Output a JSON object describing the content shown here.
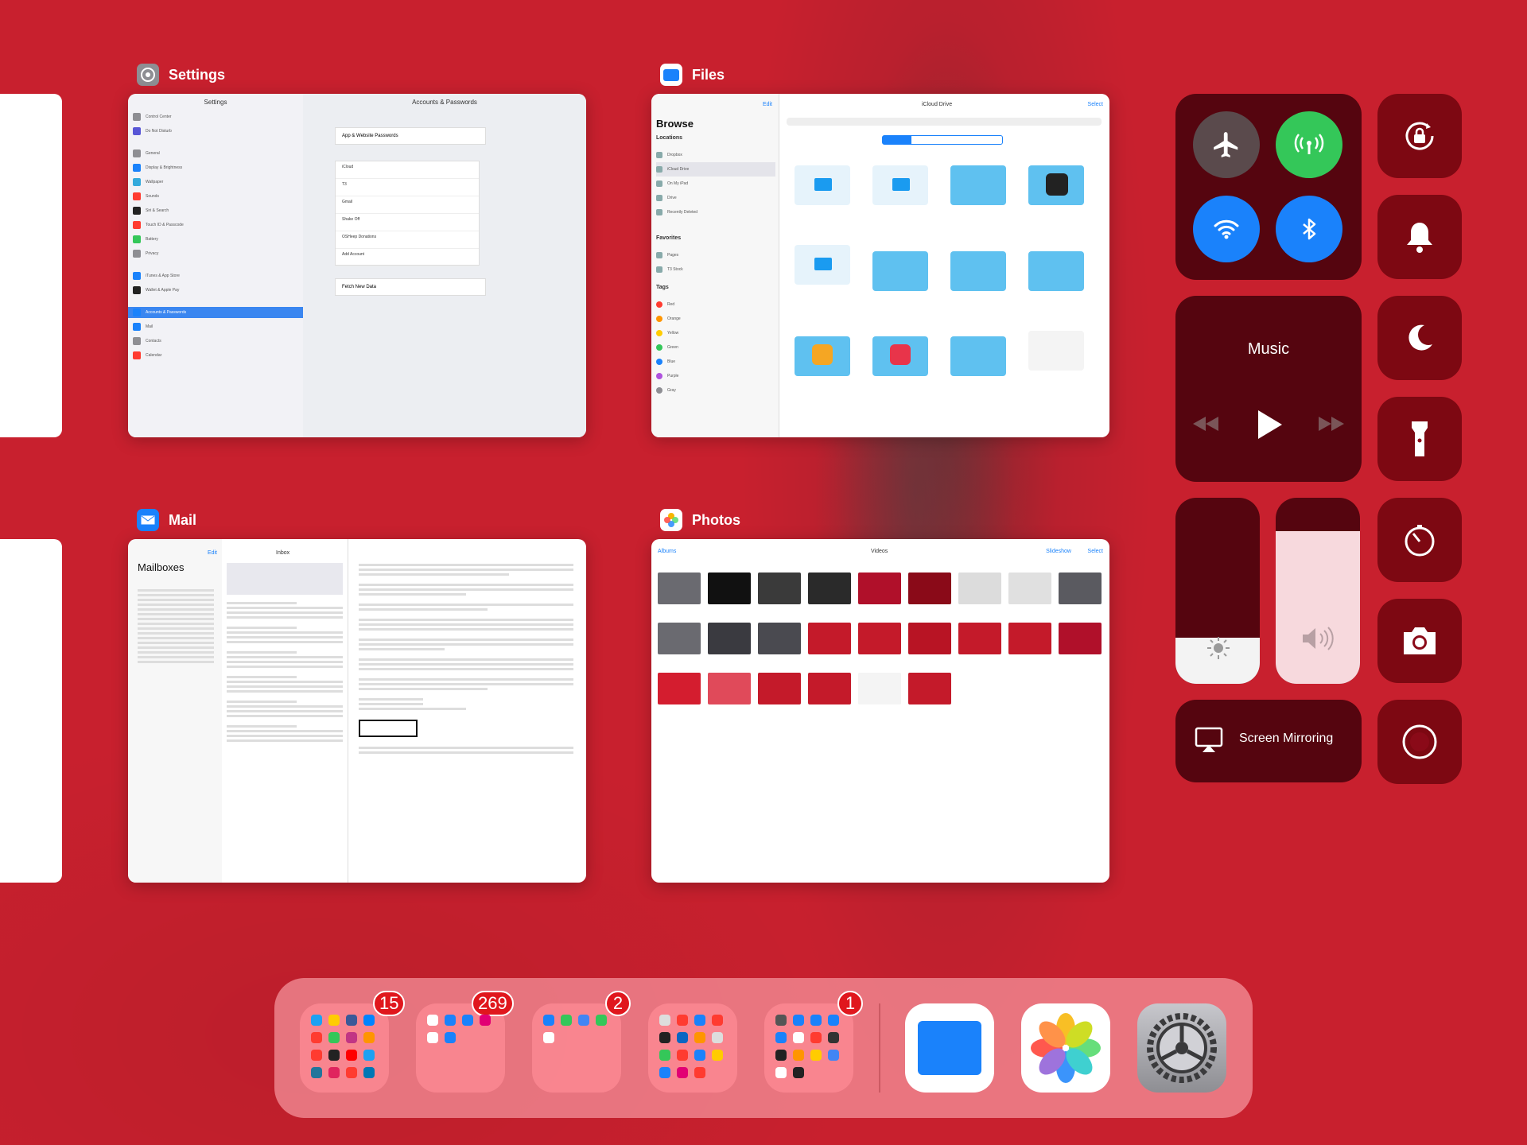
{
  "apps": {
    "settings": {
      "label": "Settings",
      "header_left": "Settings",
      "header_right": "Accounts & Passwords",
      "items": [
        "Control Center",
        "Do Not Disturb",
        "General",
        "Display & Brightness",
        "Wallpaper",
        "Sounds",
        "Siri & Search",
        "Touch ID & Passcode",
        "Battery",
        "Privacy",
        "iTunes & App Store",
        "Wallet & Apple Pay",
        "Accounts & Passwords",
        "Mail",
        "Contacts",
        "Calendar"
      ],
      "passwords_row": "App & Website Passwords",
      "accounts": [
        "iCloud",
        "T3",
        "Gmail",
        "Shake Off",
        "OSHeep Donations",
        "Add Account"
      ],
      "fetch_row": "Fetch New Data"
    },
    "files": {
      "label": "Files",
      "title": "iCloud Drive",
      "edit": "Edit",
      "select": "Select",
      "browse": "Browse",
      "locations_header": "Locations",
      "favorites_header": "Favorites",
      "tags_header": "Tags",
      "locations": [
        "Dropbox",
        "iCloud Drive",
        "On My iPad",
        "Drive",
        "Recently Deleted"
      ],
      "favorites": [
        "Pages",
        "T3 Stock"
      ],
      "tags": [
        "Red",
        "Orange",
        "Yellow",
        "Green",
        "Blue",
        "Purple",
        "Gray"
      ]
    },
    "mail": {
      "label": "Mail",
      "mailboxes": "Mailboxes",
      "inbox": "Inbox",
      "edit": "Edit"
    },
    "photos": {
      "label": "Photos",
      "back": "Albums",
      "title": "Videos",
      "slideshow": "Slideshow",
      "select": "Select"
    }
  },
  "control_center": {
    "music_title": "Music",
    "screen_mirroring": "Screen Mirroring",
    "brightness_level": 0.25,
    "volume_level": 0.82,
    "icons": [
      "airplane-icon",
      "cellular-icon",
      "wifi-icon",
      "bluetooth-icon",
      "rotation-lock-icon",
      "bell-icon",
      "moon-icon",
      "flashlight-icon",
      "timer-icon",
      "camera-icon",
      "record-icon"
    ]
  },
  "dock": {
    "folders": [
      {
        "badge": "15"
      },
      {
        "badge": "269"
      },
      {
        "badge": "2"
      },
      {
        "badge": ""
      },
      {
        "badge": "1"
      }
    ],
    "apps": [
      "files-app",
      "photos-app",
      "settings-app"
    ]
  },
  "colors": {
    "background": "#c8202e",
    "green": "#34c759",
    "blue": "#1a82fb",
    "badge": "#e0171d"
  }
}
